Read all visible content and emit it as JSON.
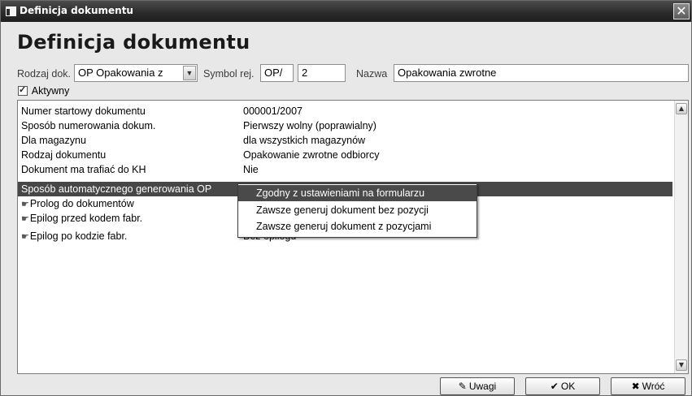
{
  "window": {
    "title": "Definicja dokumentu",
    "close_glyph": "✕"
  },
  "heading": "Definicja dokumentu",
  "form": {
    "rodzaj_label": "Rodzaj dok.",
    "rodzaj_value": "OP Opakowania z",
    "symbol_label": "Symbol rej.",
    "symbol_prefix": "OP/",
    "symbol_number": "2",
    "nazwa_label": "Nazwa",
    "nazwa_value": "Opakowania zwrotne",
    "aktywny_label": "Aktywny",
    "aktywny_checked": true
  },
  "properties": [
    {
      "label": "Numer startowy dokumentu",
      "value": "000001/2007"
    },
    {
      "label": "Sposób numerowania dokum.",
      "value": "Pierwszy wolny  (poprawialny)"
    },
    {
      "label": "Dla magazynu",
      "value": "dla wszystkich magazynów"
    },
    {
      "label": "Rodzaj dokumentu",
      "value": "Opakowanie zwrotne odbiorcy"
    },
    {
      "label": "Dokument ma trafiać do KH",
      "value": "Nie"
    },
    {
      "label": "Sposób automatycznego generowania OP",
      "value": ""
    },
    {
      "label": "Prolog do dokumentów",
      "value": ""
    },
    {
      "label": "Epilog przed kodem fabr.",
      "value": ""
    },
    {
      "label": "Epilog po kodzie fabr.",
      "value": "Bez epilogu"
    }
  ],
  "dropdown": {
    "items": [
      "Zgodny z ustawieniami na formularzu",
      "Zawsze generuj dokument bez pozycji",
      "Zawsze generuj dokument z pozycjami"
    ]
  },
  "buttons": {
    "uwagi": "Uwagi",
    "ok": "OK",
    "wroc": "Wróć"
  },
  "icons": {
    "uwagi": "pencil-icon",
    "ok": "check-icon",
    "wroc": "x-icon",
    "prolog": "hand-pointer-icon"
  },
  "colors": {
    "titlebar": "#2c2c2c",
    "selection": "#474747",
    "window_bg": "#e8e8e8"
  }
}
